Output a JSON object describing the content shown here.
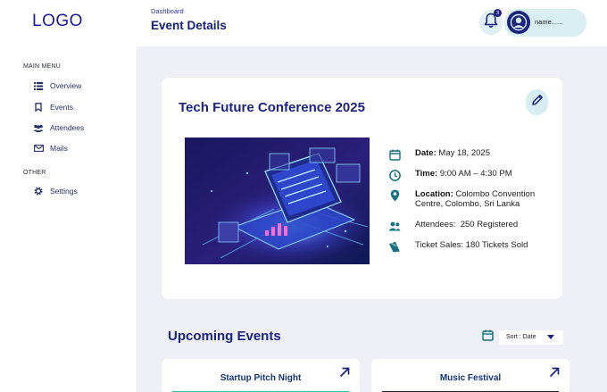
{
  "sidebar": {
    "logo": "LOGO",
    "main_menu_heading": "MAIN MENU",
    "items": [
      {
        "label": "Overview",
        "icon": "list-icon"
      },
      {
        "label": "Events",
        "icon": "bookmark-icon"
      },
      {
        "label": "Attendees",
        "icon": "people-icon"
      },
      {
        "label": "Mails",
        "icon": "mail-icon"
      }
    ],
    "other_heading": "OTHER",
    "other_items": [
      {
        "label": "Settings",
        "icon": "gear-icon"
      }
    ]
  },
  "header": {
    "breadcrumb": "Dashboard",
    "title": "Event Details",
    "notification_count": "3",
    "user_name": "name......"
  },
  "event": {
    "title": "Tech Future Conference 2025",
    "details": [
      {
        "key": "Date:",
        "value": "May 18, 2025",
        "icon": "calendar-icon"
      },
      {
        "key": "Time:",
        "value": "9:00 AM – 4:30 PM",
        "icon": "clock-icon"
      },
      {
        "key": "Location:",
        "value": "Colombo Convention Centre, Colombo, Sri Lanka",
        "icon": "location-pin-icon"
      },
      {
        "key": "Attendees:",
        "value": "250 Registered",
        "icon": "people-icon"
      },
      {
        "key": "Ticket Sales:",
        "value": "180 Tickets Sold",
        "icon": "ticket-icon"
      }
    ]
  },
  "upcoming": {
    "title": "Upcoming Events",
    "sort_label": "Sort : Date",
    "cards": [
      {
        "title": "Startup Pitch Night"
      },
      {
        "title": "Music Festival"
      }
    ]
  },
  "colors": {
    "primary": "#1a237e",
    "accent": "#16707d",
    "background": "#eef0f5"
  }
}
